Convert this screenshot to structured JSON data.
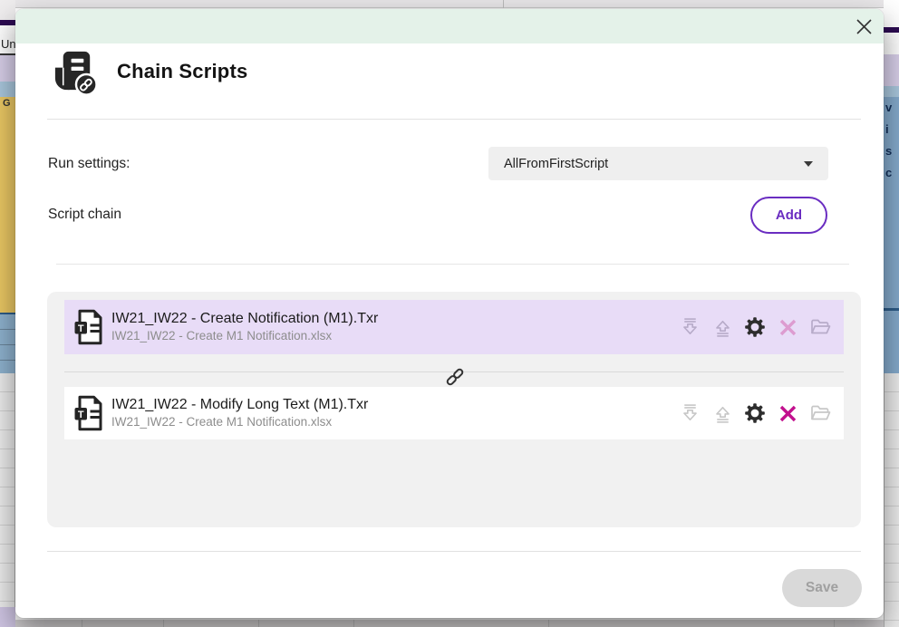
{
  "modal": {
    "title": "Chain Scripts",
    "run_settings": {
      "label": "Run settings:",
      "value": "AllFromFirstScript"
    },
    "script_chain": {
      "label": "Script chain",
      "add_label": "Add"
    },
    "scripts": [
      {
        "title": "IW21_IW22 - Create Notification (M1).Txr",
        "workbook": "IW21_IW22 - Create M1 Notification.xlsx",
        "selected": true
      },
      {
        "title": "IW21_IW22 - Modify Long Text (M1).Txr",
        "workbook": "IW21_IW22 - Create M1 Notification.xlsx",
        "selected": false
      }
    ],
    "save_label": "Save"
  },
  "background": {
    "left_cell_top": "Un",
    "left_cell_yellow": "G",
    "right_col_letters": [
      "v",
      "i",
      "s",
      "c"
    ]
  },
  "colors": {
    "header_mint": "#e4f2e9",
    "selected_row_purple": "#e8dcf7",
    "accent_purple": "#6a2dc1",
    "magenta": "#c2108e",
    "panel_gray": "#f1f1f1"
  }
}
